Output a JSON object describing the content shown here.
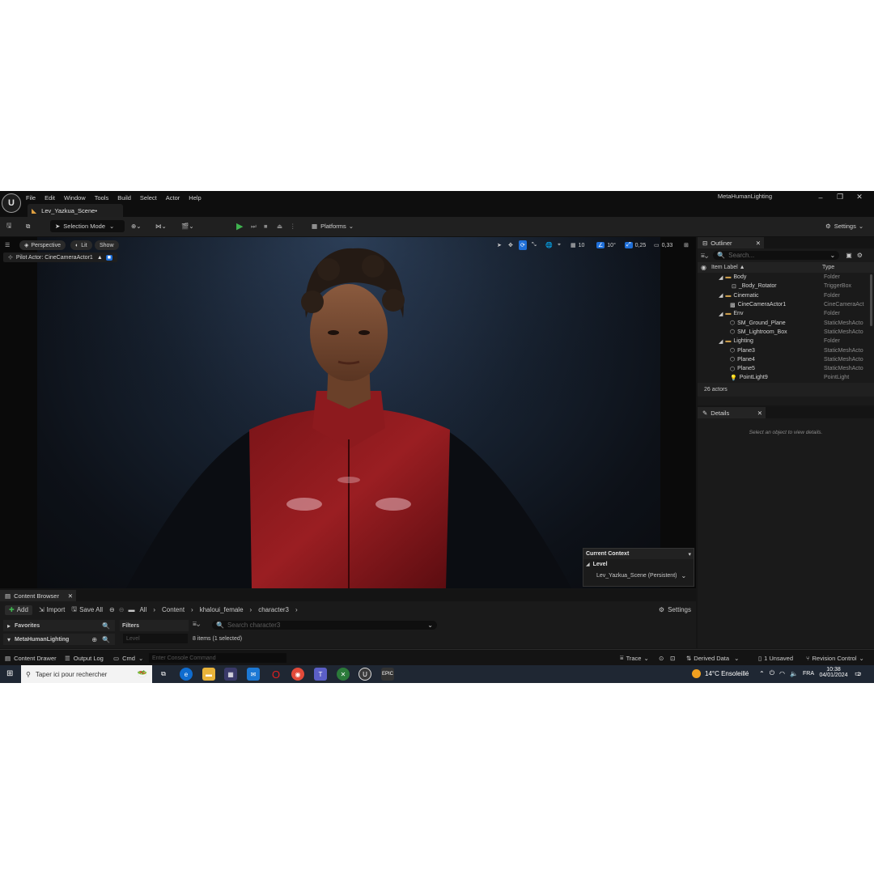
{
  "titlebar": {
    "menu": [
      "File",
      "Edit",
      "Window",
      "Tools",
      "Build",
      "Select",
      "Actor",
      "Help"
    ],
    "tab_label": "Lev_Yazkua_Scene•",
    "project_name": "MetaHumanLighting"
  },
  "toolbar": {
    "selection_mode": "Selection Mode",
    "platforms": "Platforms",
    "settings": "Settings"
  },
  "viewport": {
    "perspective": "Perspective",
    "lit": "Lit",
    "show": "Show",
    "pilot_actor": "Pilot Actor: CineCameraActor1",
    "grid_snap": "10",
    "rotation_snap": "10°",
    "scale_snap": "0,25",
    "camera_speed": "0,33",
    "context": {
      "title": "Current Context",
      "level_label": "Level",
      "level_value": "Lev_Yazkua_Scene (Persistent)"
    }
  },
  "outliner": {
    "title": "Outliner",
    "search_placeholder": "Search...",
    "col_label": "Item Label ▲",
    "col_type": "Type",
    "rows": [
      {
        "label": "Body",
        "type": "Folder"
      },
      {
        "label": "_Body_Rotator",
        "type": "TriggerBox"
      },
      {
        "label": "Cinematic",
        "type": "Folder"
      },
      {
        "label": "CineCameraActor1",
        "type": "CineCameraAct"
      },
      {
        "label": "Env",
        "type": "Folder"
      },
      {
        "label": "SM_Ground_Plane",
        "type": "StaticMeshActo"
      },
      {
        "label": "SM_Lightroom_Box",
        "type": "StaticMeshActo"
      },
      {
        "label": "Lighting",
        "type": "Folder"
      },
      {
        "label": "Plane3",
        "type": "StaticMeshActo"
      },
      {
        "label": "Plane4",
        "type": "StaticMeshActo"
      },
      {
        "label": "Plane5",
        "type": "StaticMeshActo"
      },
      {
        "label": "PointLight9",
        "type": "PointLight"
      }
    ],
    "count": "26 actors"
  },
  "details": {
    "title": "Details",
    "empty_text": "Select an object to view details."
  },
  "content_browser": {
    "title": "Content Browser",
    "add": "Add",
    "import": "Import",
    "save_all": "Save All",
    "breadcrumb": [
      "All",
      "Content",
      "khaloui_female",
      "character3"
    ],
    "settings": "Settings",
    "favorites": "Favorites",
    "project": "MetaHumanLighting",
    "filters": "Filters",
    "search_placeholder": "Search character3",
    "filter_placeholder": "Level",
    "items_status": "8 items (1 selected)"
  },
  "statusbar": {
    "content_drawer": "Content Drawer",
    "output_log": "Output Log",
    "cmd": "Cmd",
    "console_placeholder": "Enter Console Command",
    "trace": "Trace",
    "derived_data": "Derived Data",
    "unsaved": "1 Unsaved",
    "revision_control": "Revision Control"
  },
  "taskbar": {
    "search_placeholder": "Taper ici pour rechercher",
    "weather": "14°C  Ensoleillé",
    "lang": "FRA",
    "time": "10:38",
    "date": "04/01/2024",
    "notif_count": "2"
  }
}
